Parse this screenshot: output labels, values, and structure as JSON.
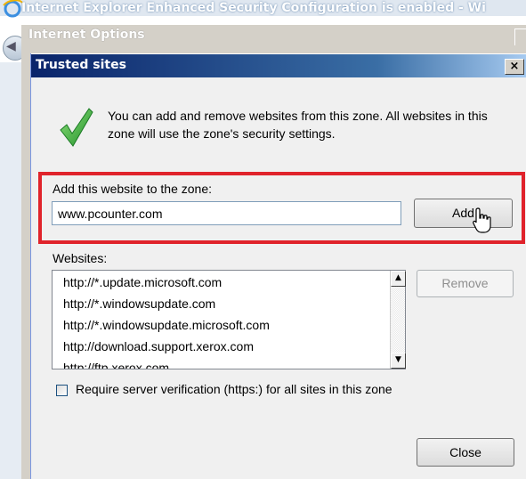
{
  "ie_window": {
    "title": "Internet Explorer Enhanced Security Configuration is enabled - Wi"
  },
  "internet_options": {
    "title": "Internet Options",
    "close_glyph": "×"
  },
  "dialog": {
    "title": "Trusted sites",
    "close_glyph": "×",
    "info_text": "You can add and remove websites from this zone. All websites in this zone will use the zone's security settings.",
    "add_label": "Add this website to the zone:",
    "url_value": "www.pcounter.com",
    "add_button": "Add",
    "websites_label": "Websites:",
    "websites": [
      "http://*.update.microsoft.com",
      "http://*.windowsupdate.com",
      "http://*.windowsupdate.microsoft.com",
      "http://download.support.xerox.com",
      "http://ftp.xerox.com"
    ],
    "remove_button": "Remove",
    "https_label": "Require server verification (https:) for all sites in this zone",
    "https_checked": false,
    "close_button": "Close",
    "scroll_up_glyph": "▲",
    "scroll_down_glyph": "▼"
  },
  "colors": {
    "highlight_border": "#e0232b",
    "titlebar": "#0a246a"
  }
}
